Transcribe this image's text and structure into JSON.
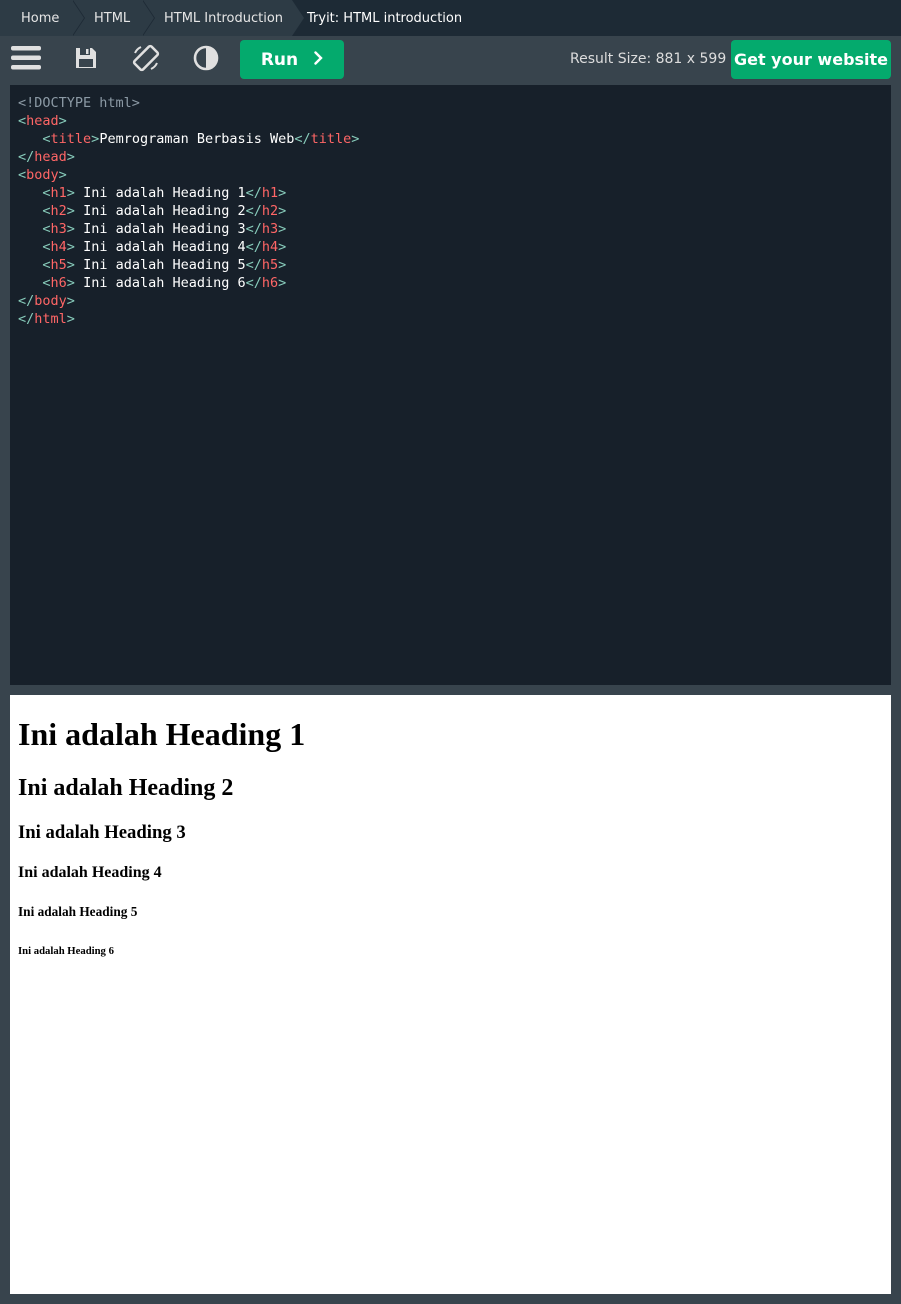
{
  "breadcrumb": [
    "Home",
    "HTML",
    "HTML Introduction",
    "Tryit: HTML introduction"
  ],
  "toolbar": {
    "menu_icon": "hamburger-icon",
    "save_icon": "floppy-disk-icon",
    "rotate_icon": "rotate-screen-icon",
    "theme_icon": "contrast-icon",
    "run_label": "Run",
    "run_icon": "chevron-right-icon",
    "result_size": "Result Size: 881 x 599",
    "website_label": "Get your website"
  },
  "editor": {
    "doctype": "<!DOCTYPE html>",
    "title_text": "Pemrograman Berbasis Web",
    "headings": [
      {
        "tag": "h1",
        "text": " Ini adalah Heading 1"
      },
      {
        "tag": "h2",
        "text": " Ini adalah Heading 2"
      },
      {
        "tag": "h3",
        "text": " Ini adalah Heading 3"
      },
      {
        "tag": "h4",
        "text": " Ini adalah Heading 4"
      },
      {
        "tag": "h5",
        "text": " Ini adalah Heading 5"
      },
      {
        "tag": "h6",
        "text": " Ini adalah Heading 6"
      }
    ],
    "tags": {
      "head": "head",
      "title": "title",
      "body": "body",
      "html": "html"
    }
  },
  "result": {
    "h1": "Ini adalah Heading 1",
    "h2": "Ini adalah Heading 2",
    "h3": "Ini adalah Heading 3",
    "h4": "Ini adalah Heading 4",
    "h5": "Ini adalah Heading 5",
    "h6": "Ini adalah Heading 6"
  },
  "colors": {
    "accent": "#04aa6d",
    "editor_bg": "#17202a",
    "tag": "#ff6666",
    "bracket": "#88ccbb"
  }
}
